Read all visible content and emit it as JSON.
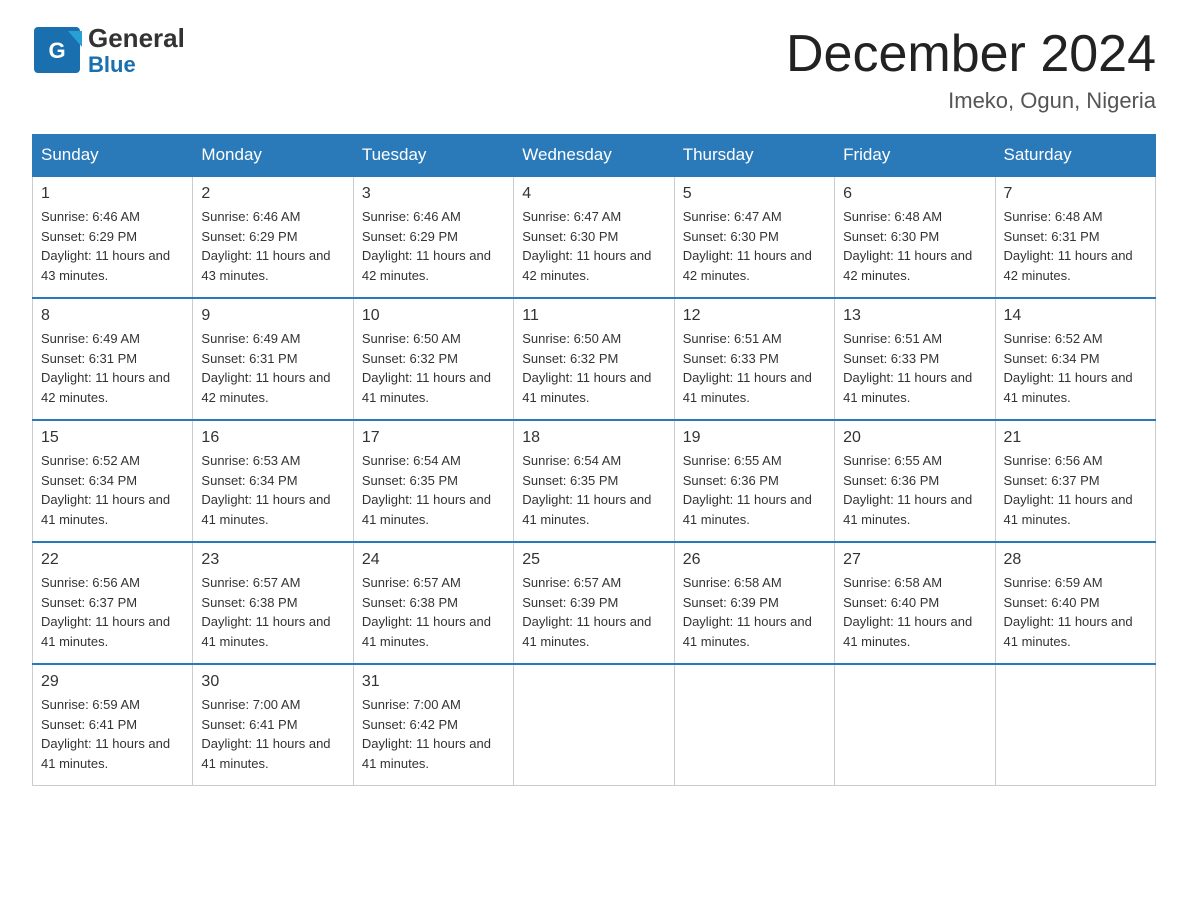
{
  "header": {
    "logo_general": "General",
    "logo_blue": "Blue",
    "month_title": "December 2024",
    "location": "Imeko, Ogun, Nigeria"
  },
  "days_of_week": [
    "Sunday",
    "Monday",
    "Tuesday",
    "Wednesday",
    "Thursday",
    "Friday",
    "Saturday"
  ],
  "weeks": [
    [
      {
        "day": "1",
        "sunrise": "6:46 AM",
        "sunset": "6:29 PM",
        "daylight": "11 hours and 43 minutes."
      },
      {
        "day": "2",
        "sunrise": "6:46 AM",
        "sunset": "6:29 PM",
        "daylight": "11 hours and 43 minutes."
      },
      {
        "day": "3",
        "sunrise": "6:46 AM",
        "sunset": "6:29 PM",
        "daylight": "11 hours and 42 minutes."
      },
      {
        "day": "4",
        "sunrise": "6:47 AM",
        "sunset": "6:30 PM",
        "daylight": "11 hours and 42 minutes."
      },
      {
        "day": "5",
        "sunrise": "6:47 AM",
        "sunset": "6:30 PM",
        "daylight": "11 hours and 42 minutes."
      },
      {
        "day": "6",
        "sunrise": "6:48 AM",
        "sunset": "6:30 PM",
        "daylight": "11 hours and 42 minutes."
      },
      {
        "day": "7",
        "sunrise": "6:48 AM",
        "sunset": "6:31 PM",
        "daylight": "11 hours and 42 minutes."
      }
    ],
    [
      {
        "day": "8",
        "sunrise": "6:49 AM",
        "sunset": "6:31 PM",
        "daylight": "11 hours and 42 minutes."
      },
      {
        "day": "9",
        "sunrise": "6:49 AM",
        "sunset": "6:31 PM",
        "daylight": "11 hours and 42 minutes."
      },
      {
        "day": "10",
        "sunrise": "6:50 AM",
        "sunset": "6:32 PM",
        "daylight": "11 hours and 41 minutes."
      },
      {
        "day": "11",
        "sunrise": "6:50 AM",
        "sunset": "6:32 PM",
        "daylight": "11 hours and 41 minutes."
      },
      {
        "day": "12",
        "sunrise": "6:51 AM",
        "sunset": "6:33 PM",
        "daylight": "11 hours and 41 minutes."
      },
      {
        "day": "13",
        "sunrise": "6:51 AM",
        "sunset": "6:33 PM",
        "daylight": "11 hours and 41 minutes."
      },
      {
        "day": "14",
        "sunrise": "6:52 AM",
        "sunset": "6:34 PM",
        "daylight": "11 hours and 41 minutes."
      }
    ],
    [
      {
        "day": "15",
        "sunrise": "6:52 AM",
        "sunset": "6:34 PM",
        "daylight": "11 hours and 41 minutes."
      },
      {
        "day": "16",
        "sunrise": "6:53 AM",
        "sunset": "6:34 PM",
        "daylight": "11 hours and 41 minutes."
      },
      {
        "day": "17",
        "sunrise": "6:54 AM",
        "sunset": "6:35 PM",
        "daylight": "11 hours and 41 minutes."
      },
      {
        "day": "18",
        "sunrise": "6:54 AM",
        "sunset": "6:35 PM",
        "daylight": "11 hours and 41 minutes."
      },
      {
        "day": "19",
        "sunrise": "6:55 AM",
        "sunset": "6:36 PM",
        "daylight": "11 hours and 41 minutes."
      },
      {
        "day": "20",
        "sunrise": "6:55 AM",
        "sunset": "6:36 PM",
        "daylight": "11 hours and 41 minutes."
      },
      {
        "day": "21",
        "sunrise": "6:56 AM",
        "sunset": "6:37 PM",
        "daylight": "11 hours and 41 minutes."
      }
    ],
    [
      {
        "day": "22",
        "sunrise": "6:56 AM",
        "sunset": "6:37 PM",
        "daylight": "11 hours and 41 minutes."
      },
      {
        "day": "23",
        "sunrise": "6:57 AM",
        "sunset": "6:38 PM",
        "daylight": "11 hours and 41 minutes."
      },
      {
        "day": "24",
        "sunrise": "6:57 AM",
        "sunset": "6:38 PM",
        "daylight": "11 hours and 41 minutes."
      },
      {
        "day": "25",
        "sunrise": "6:57 AM",
        "sunset": "6:39 PM",
        "daylight": "11 hours and 41 minutes."
      },
      {
        "day": "26",
        "sunrise": "6:58 AM",
        "sunset": "6:39 PM",
        "daylight": "11 hours and 41 minutes."
      },
      {
        "day": "27",
        "sunrise": "6:58 AM",
        "sunset": "6:40 PM",
        "daylight": "11 hours and 41 minutes."
      },
      {
        "day": "28",
        "sunrise": "6:59 AM",
        "sunset": "6:40 PM",
        "daylight": "11 hours and 41 minutes."
      }
    ],
    [
      {
        "day": "29",
        "sunrise": "6:59 AM",
        "sunset": "6:41 PM",
        "daylight": "11 hours and 41 minutes."
      },
      {
        "day": "30",
        "sunrise": "7:00 AM",
        "sunset": "6:41 PM",
        "daylight": "11 hours and 41 minutes."
      },
      {
        "day": "31",
        "sunrise": "7:00 AM",
        "sunset": "6:42 PM",
        "daylight": "11 hours and 41 minutes."
      },
      null,
      null,
      null,
      null
    ]
  ],
  "labels": {
    "sunrise": "Sunrise:",
    "sunset": "Sunset:",
    "daylight": "Daylight:"
  }
}
